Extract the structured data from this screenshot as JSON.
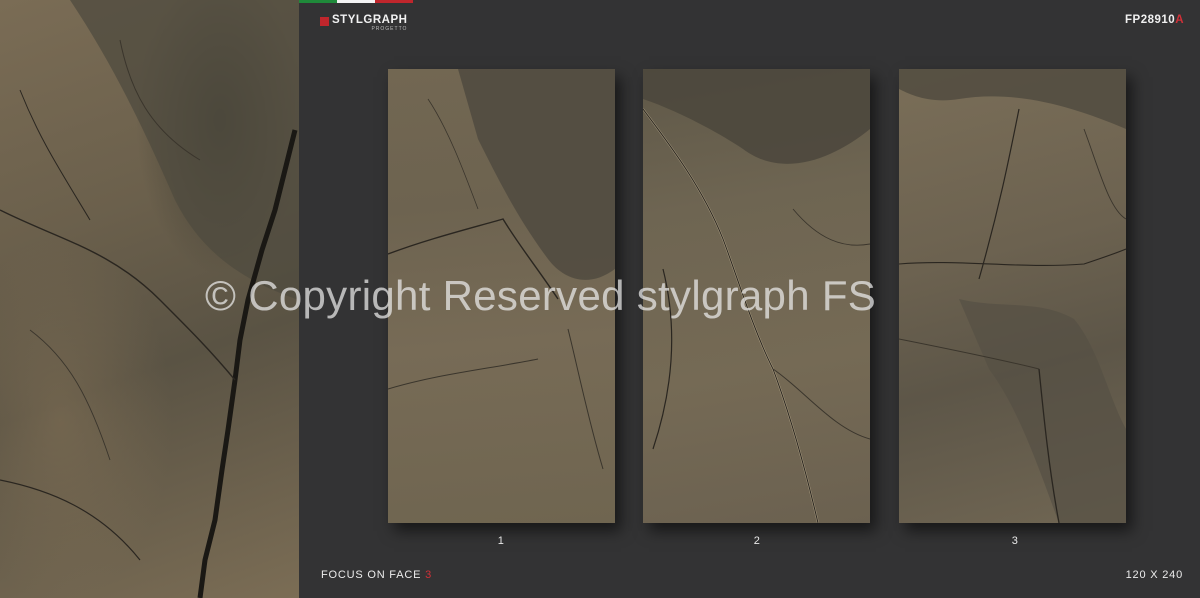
{
  "brand": {
    "name": "STYLGRAPH",
    "sub": "PROGETTO"
  },
  "product_code": {
    "main": "FP28910",
    "suffix": "A"
  },
  "faces": [
    {
      "number": "1"
    },
    {
      "number": "2"
    },
    {
      "number": "3"
    }
  ],
  "footer": {
    "focus_text": "FOCUS ON FACE",
    "focus_face": "3",
    "size": "120 X 240"
  },
  "watermark": "© Copyright Reserved stylgraph FS",
  "colors": {
    "background": "#333334",
    "accent": "#d13038",
    "flag": [
      "#1f8a3a",
      "#f4f4f4",
      "#c0262c"
    ]
  }
}
